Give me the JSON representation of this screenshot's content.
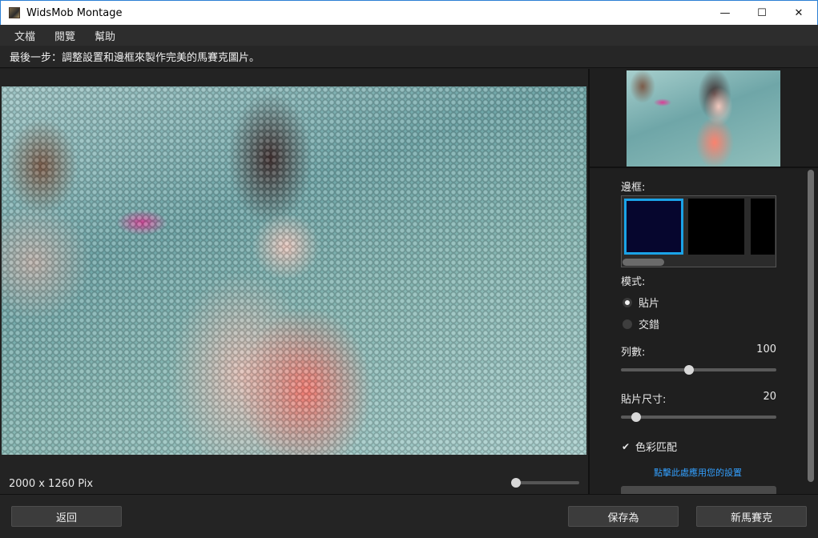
{
  "window": {
    "title": "WidsMob Montage",
    "controls": {
      "minimize": "—",
      "maximize": "☐",
      "close": "✕"
    }
  },
  "menu": {
    "items": [
      "文檔",
      "閱覽",
      "幫助"
    ]
  },
  "instruction": "最後一步：調整設置和邊框來製作完美的馬賽克圖片。",
  "preview": {
    "dimensions": "2000 x 1260 Pix",
    "zoom_level": 0.05
  },
  "settings": {
    "border_label": "邊框:",
    "border_options": [
      {
        "color": "#06062e",
        "selected": true
      },
      {
        "color": "#000000",
        "selected": false
      },
      {
        "color": "#000000",
        "selected": false
      }
    ],
    "mode_label": "模式:",
    "modes": [
      {
        "label": "貼片",
        "selected": true
      },
      {
        "label": "交錯",
        "selected": false
      }
    ],
    "columns_label": "列數:",
    "columns_value": "100",
    "columns_fraction": 0.44,
    "tile_size_label": "貼片尺寸:",
    "tile_size_value": "20",
    "tile_size_fraction": 0.1,
    "color_match_label": "色彩匹配",
    "color_match_checked": true,
    "apply_link": "點擊此處應用您的設置"
  },
  "footer": {
    "back": "返回",
    "save_as": "保存為",
    "new_mosaic": "新馬賽克"
  },
  "colors": {
    "accent": "#1aa3e8",
    "link": "#33a0ff",
    "background": "#1e1e1e"
  }
}
